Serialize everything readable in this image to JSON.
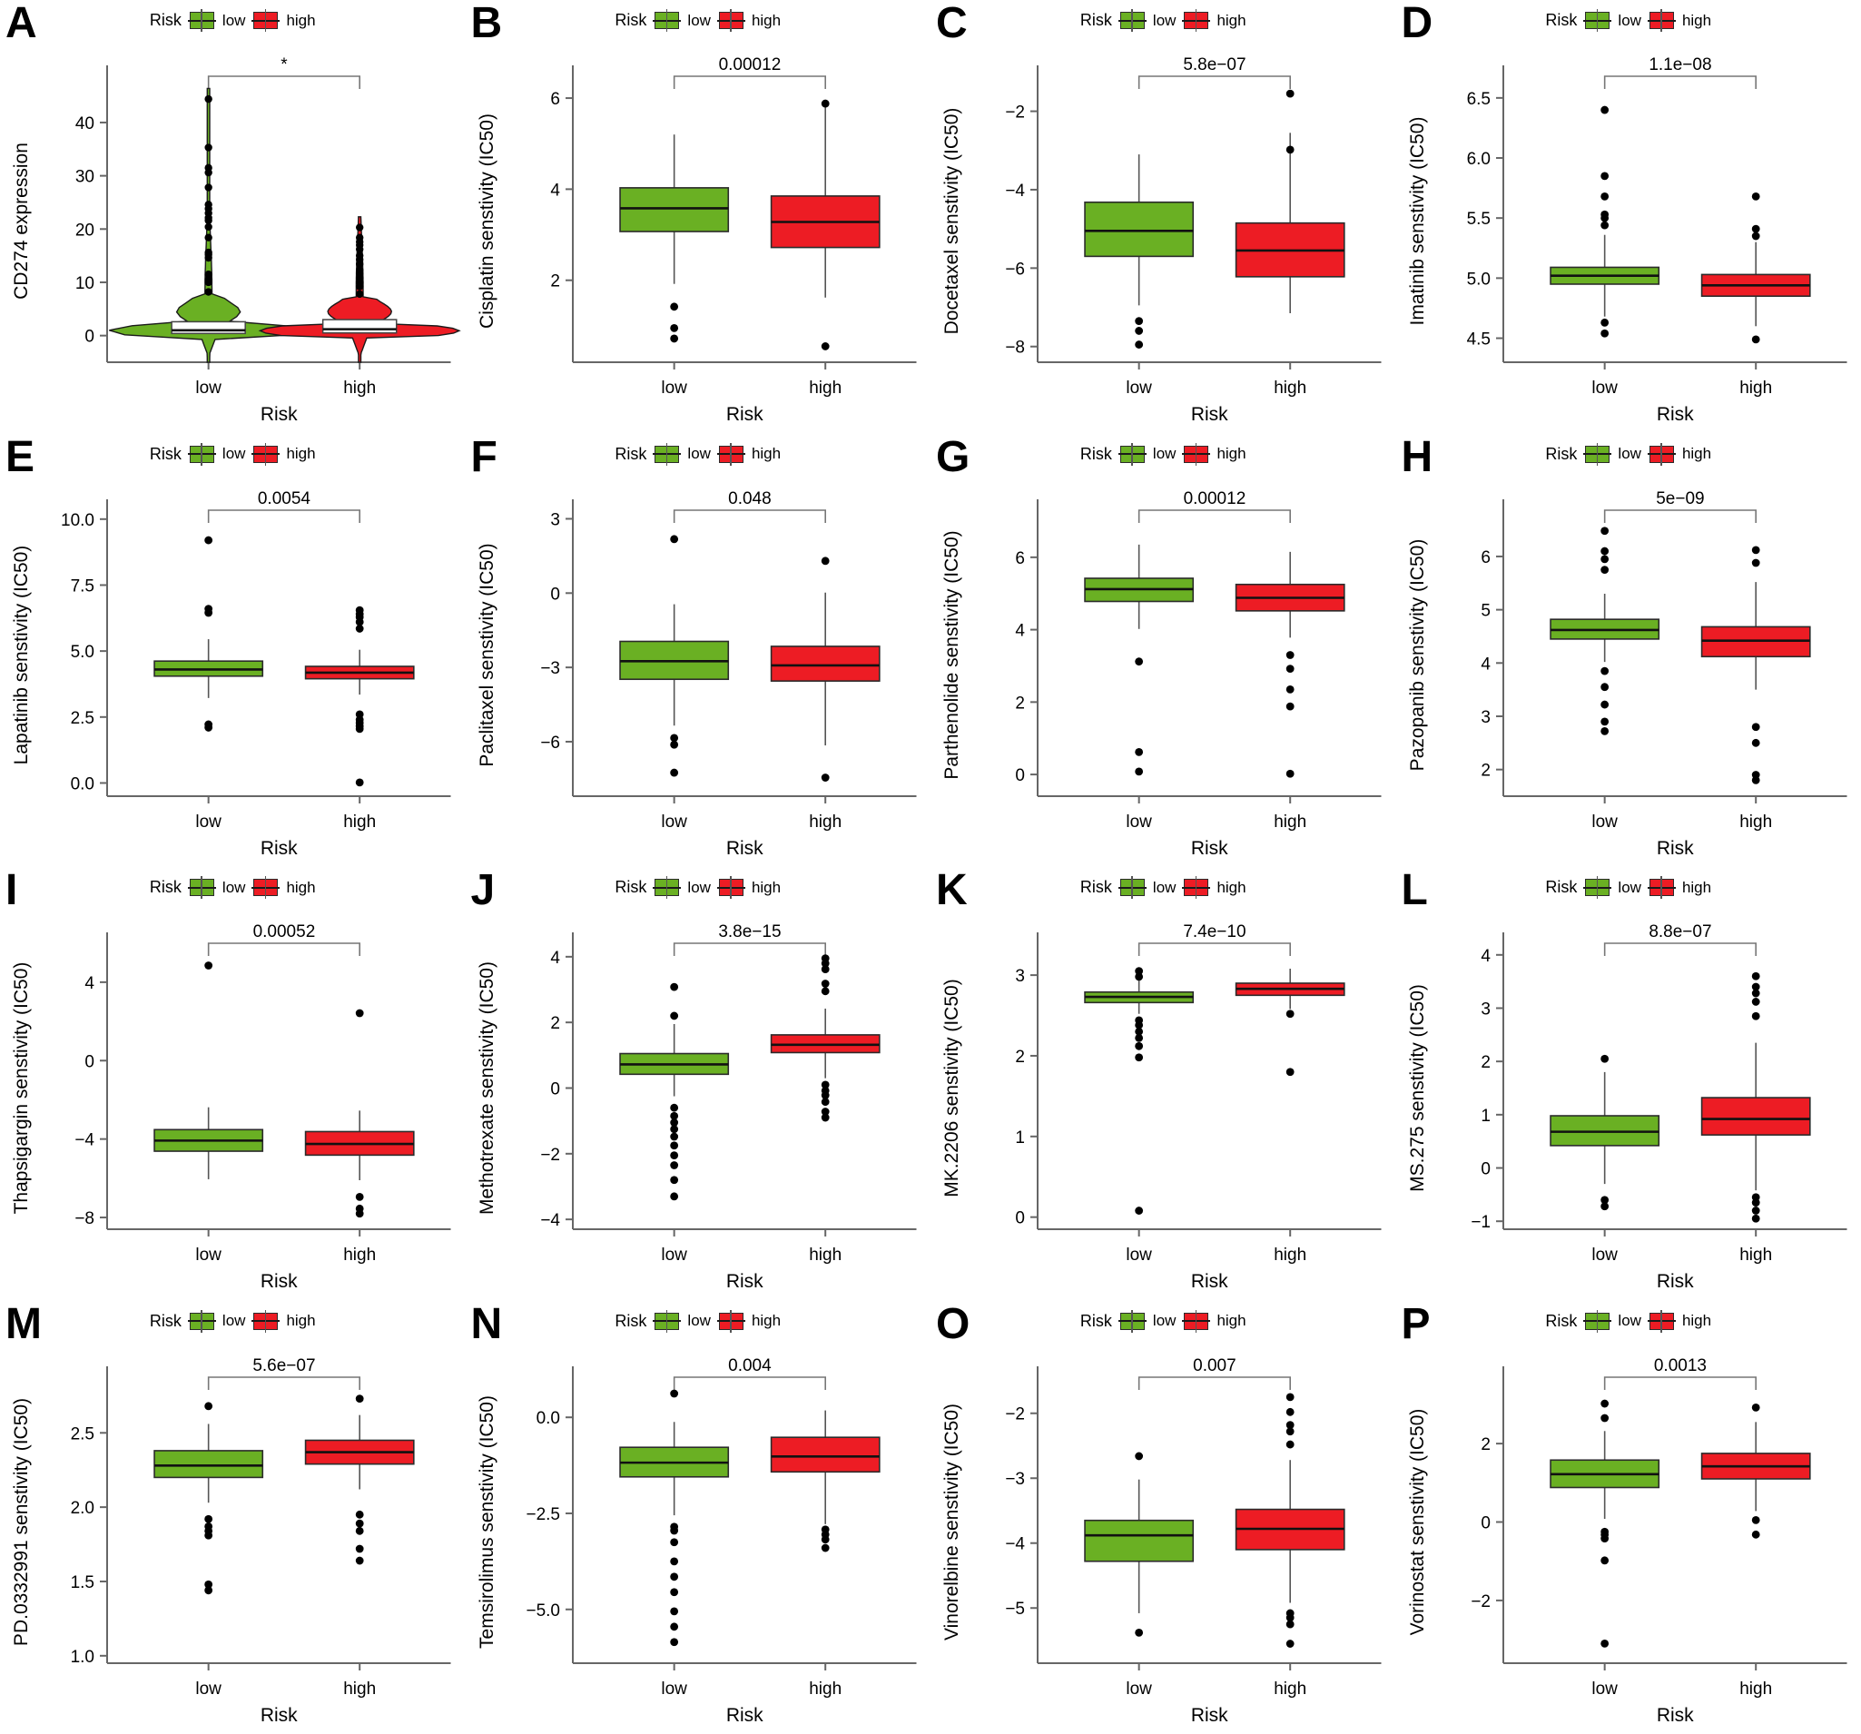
{
  "figure": {
    "legend": {
      "title": "Risk",
      "low_label": "low",
      "high_label": "high"
    },
    "colors": {
      "low": "#6ab023",
      "high": "#ed1c24",
      "axis": "#666666",
      "outlier": "#000000"
    },
    "xlabel": "Risk",
    "xticks": [
      "low",
      "high"
    ]
  },
  "chart_data": [
    {
      "panel": "A",
      "type": "violin",
      "title": "",
      "ylabel": "CD274 expression",
      "xlabel": "Risk",
      "categories": [
        "low",
        "high"
      ],
      "ylim": [
        -5,
        48
      ],
      "yticks": [
        0,
        10,
        20,
        30,
        40
      ],
      "ytick_labels": [
        "0",
        "10",
        "20",
        "30",
        "40"
      ],
      "pvalue": "*",
      "grid": false,
      "legend_position": "top-center",
      "series": [
        {
          "name": "low",
          "color": "#6ab023",
          "median": 1.0,
          "q1": 0.4,
          "q3": 2.6,
          "whisker_low": 0.0,
          "whisker_high": 5.2,
          "outliers": [
            8.2,
            10.0,
            10.5,
            11.5,
            14.6,
            15.2,
            15.6,
            18.4,
            20.4,
            21.6,
            22.1,
            23.0,
            23.8,
            24.6,
            27.8,
            30.6,
            31.5,
            35.3,
            44.4
          ]
        },
        {
          "name": "high",
          "color": "#ed1c24",
          "median": 1.2,
          "q1": 0.5,
          "q3": 3.0,
          "whisker_low": 0.0,
          "whisker_high": 6.0,
          "outliers": [
            7.8,
            9.2,
            10.0,
            10.8,
            11.6,
            12.3,
            13.4,
            14.3,
            15.0,
            16.2,
            17.0,
            17.6,
            18.4,
            20.3
          ]
        }
      ]
    },
    {
      "panel": "B",
      "type": "box",
      "ylabel": "Cisplatin senstivity (IC50)",
      "xlabel": "Risk",
      "categories": [
        "low",
        "high"
      ],
      "ylim": [
        0.2,
        6.4
      ],
      "yticks": [
        2,
        4,
        6
      ],
      "ytick_labels": [
        "2",
        "4",
        "6"
      ],
      "pvalue": "0.00012",
      "grid": false,
      "series": [
        {
          "name": "low",
          "color": "#6ab023",
          "median": 3.58,
          "q1": 3.07,
          "q3": 4.03,
          "whisker_low": 1.92,
          "whisker_high": 5.2,
          "outliers": [
            1.42,
            0.95,
            0.72
          ]
        },
        {
          "name": "high",
          "color": "#ed1c24",
          "median": 3.28,
          "q1": 2.72,
          "q3": 3.85,
          "whisker_low": 1.62,
          "whisker_high": 5.88,
          "outliers": [
            5.88,
            0.55
          ]
        }
      ]
    },
    {
      "panel": "C",
      "type": "box",
      "ylabel": "Docetaxel senstivity (IC50)",
      "xlabel": "Risk",
      "categories": [
        "low",
        "high"
      ],
      "ylim": [
        -8.4,
        -1.2
      ],
      "yticks": [
        -8,
        -6,
        -4,
        -2
      ],
      "ytick_labels": [
        "-8",
        "-6",
        "-4",
        "-2"
      ],
      "pvalue": "5.8e-07",
      "grid": false,
      "series": [
        {
          "name": "low",
          "color": "#6ab023",
          "median": -5.05,
          "q1": -5.7,
          "q3": -4.32,
          "whisker_low": -6.95,
          "whisker_high": -3.1,
          "outliers": [
            -7.35,
            -7.6,
            -7.95
          ]
        },
        {
          "name": "high",
          "color": "#ed1c24",
          "median": -5.55,
          "q1": -6.22,
          "q3": -4.85,
          "whisker_low": -7.15,
          "whisker_high": -2.55,
          "outliers": [
            -1.55,
            -2.98
          ]
        }
      ]
    },
    {
      "panel": "D",
      "type": "box",
      "ylabel": "Imatinib senstivity (IC50)",
      "xlabel": "Risk",
      "categories": [
        "low",
        "high"
      ],
      "ylim": [
        4.3,
        6.65
      ],
      "yticks": [
        4.5,
        5.0,
        5.5,
        6.0,
        6.5
      ],
      "ytick_labels": [
        "4.5",
        "5.0",
        "5.5",
        "6.0",
        "6.5"
      ],
      "pvalue": "1.1e-08",
      "grid": false,
      "series": [
        {
          "name": "low",
          "color": "#6ab023",
          "median": 5.02,
          "q1": 4.95,
          "q3": 5.09,
          "whisker_low": 4.68,
          "whisker_high": 5.36,
          "outliers": [
            6.4,
            5.85,
            5.68,
            5.53,
            5.5,
            5.44,
            4.63,
            4.54
          ]
        },
        {
          "name": "high",
          "color": "#ed1c24",
          "median": 4.94,
          "q1": 4.85,
          "q3": 5.03,
          "whisker_low": 4.6,
          "whisker_high": 5.3,
          "outliers": [
            5.68,
            5.41,
            5.35,
            4.49
          ]
        }
      ]
    },
    {
      "panel": "E",
      "type": "box",
      "ylabel": "Lapatinib senstivity (IC50)",
      "xlabel": "Risk",
      "categories": [
        "low",
        "high"
      ],
      "ylim": [
        -0.5,
        10.2
      ],
      "yticks": [
        0.0,
        2.5,
        5.0,
        7.5,
        10.0
      ],
      "ytick_labels": [
        "0.0",
        "2.5",
        "5.0",
        "7.5",
        "10.0"
      ],
      "pvalue": "0.0054",
      "grid": false,
      "series": [
        {
          "name": "low",
          "color": "#6ab023",
          "median": 4.3,
          "q1": 4.05,
          "q3": 4.62,
          "whisker_low": 3.22,
          "whisker_high": 5.45,
          "outliers": [
            9.2,
            6.6,
            6.45,
            2.22,
            2.1
          ]
        },
        {
          "name": "high",
          "color": "#ed1c24",
          "median": 4.18,
          "q1": 3.95,
          "q3": 4.42,
          "whisker_low": 3.35,
          "whisker_high": 5.05,
          "outliers": [
            6.55,
            6.4,
            6.28,
            6.1,
            5.85,
            2.6,
            2.4,
            2.28,
            2.15,
            2.05,
            0.02
          ]
        }
      ]
    },
    {
      "panel": "F",
      "type": "box",
      "ylabel": "Paclitaxel senstivity (IC50)",
      "xlabel": "Risk",
      "categories": [
        "low",
        "high"
      ],
      "ylim": [
        -8.2,
        3.2
      ],
      "yticks": [
        -6,
        -3,
        0,
        3
      ],
      "ytick_labels": [
        "-6",
        "-3",
        "0",
        "3"
      ],
      "pvalue": "0.048",
      "grid": false,
      "series": [
        {
          "name": "low",
          "color": "#6ab023",
          "median": -2.75,
          "q1": -3.48,
          "q3": -1.95,
          "whisker_low": -5.35,
          "whisker_high": -0.45,
          "outliers": [
            2.18,
            -5.85,
            -6.12,
            -7.25
          ]
        },
        {
          "name": "high",
          "color": "#ed1c24",
          "median": -2.92,
          "q1": -3.55,
          "q3": -2.15,
          "whisker_low": -6.15,
          "whisker_high": 0.02,
          "outliers": [
            1.3,
            -7.45
          ]
        }
      ]
    },
    {
      "panel": "G",
      "type": "box",
      "ylabel": "Parthenolide senstivity (IC50)",
      "xlabel": "Risk",
      "categories": [
        "low",
        "high"
      ],
      "ylim": [
        -0.6,
        7.2
      ],
      "yticks": [
        0,
        2,
        4,
        6
      ],
      "ytick_labels": [
        "0",
        "2",
        "4",
        "6"
      ],
      "pvalue": "0.00012",
      "grid": false,
      "series": [
        {
          "name": "low",
          "color": "#6ab023",
          "median": 5.12,
          "q1": 4.78,
          "q3": 5.42,
          "whisker_low": 4.02,
          "whisker_high": 6.35,
          "outliers": [
            3.12,
            0.62,
            0.08
          ]
        },
        {
          "name": "high",
          "color": "#ed1c24",
          "median": 4.88,
          "q1": 4.52,
          "q3": 5.25,
          "whisker_low": 3.78,
          "whisker_high": 6.15,
          "outliers": [
            3.3,
            2.92,
            2.35,
            1.88,
            0.02
          ]
        }
      ]
    },
    {
      "panel": "H",
      "type": "box",
      "ylabel": "Pazopanib senstivity (IC50)",
      "xlabel": "Risk",
      "categories": [
        "low",
        "high"
      ],
      "ylim": [
        1.5,
        6.8
      ],
      "yticks": [
        2,
        3,
        4,
        5,
        6
      ],
      "ytick_labels": [
        "2",
        "3",
        "4",
        "5",
        "6"
      ],
      "pvalue": "5e-09",
      "grid": false,
      "series": [
        {
          "name": "low",
          "color": "#6ab023",
          "median": 4.62,
          "q1": 4.45,
          "q3": 4.82,
          "whisker_low": 4.02,
          "whisker_high": 5.3,
          "outliers": [
            6.48,
            6.1,
            5.95,
            5.75,
            3.85,
            3.55,
            3.22,
            2.9,
            2.72
          ]
        },
        {
          "name": "high",
          "color": "#ed1c24",
          "median": 4.42,
          "q1": 4.12,
          "q3": 4.68,
          "whisker_low": 3.5,
          "whisker_high": 5.52,
          "outliers": [
            6.12,
            5.88,
            2.8,
            2.5,
            1.9,
            1.8
          ]
        }
      ]
    },
    {
      "panel": "I",
      "type": "box",
      "ylabel": "Thapsigargin senstivity (IC50)",
      "xlabel": "Risk",
      "categories": [
        "low",
        "high"
      ],
      "ylim": [
        -8.6,
        5.8
      ],
      "yticks": [
        -8,
        -4,
        0,
        4
      ],
      "ytick_labels": [
        "-8",
        "-4",
        "0",
        "4"
      ],
      "pvalue": "0.00052",
      "grid": false,
      "series": [
        {
          "name": "low",
          "color": "#6ab023",
          "median": -4.08,
          "q1": -4.62,
          "q3": -3.52,
          "whisker_low": -6.05,
          "whisker_high": -2.38,
          "outliers": [
            4.85
          ]
        },
        {
          "name": "high",
          "color": "#ed1c24",
          "median": -4.25,
          "q1": -4.82,
          "q3": -3.62,
          "whisker_low": -6.1,
          "whisker_high": -2.55,
          "outliers": [
            2.42,
            -6.95,
            -7.55,
            -7.8
          ]
        }
      ]
    },
    {
      "panel": "J",
      "type": "box",
      "ylabel": "Methotrexate senstivity (IC50)",
      "xlabel": "Risk",
      "categories": [
        "low",
        "high"
      ],
      "ylim": [
        -4.3,
        4.3
      ],
      "yticks": [
        -4,
        -2,
        0,
        2,
        4
      ],
      "ytick_labels": [
        "-4",
        "-2",
        "0",
        "2",
        "4"
      ],
      "pvalue": "3.8e-15",
      "grid": false,
      "series": [
        {
          "name": "low",
          "color": "#6ab023",
          "median": 0.72,
          "q1": 0.42,
          "q3": 1.05,
          "whisker_low": -0.25,
          "whisker_high": 1.95,
          "outliers": [
            3.08,
            2.2,
            -0.6,
            -0.85,
            -1.05,
            -1.25,
            -1.48,
            -1.75,
            -2.05,
            -2.35,
            -2.8,
            -3.3
          ]
        },
        {
          "name": "high",
          "color": "#ed1c24",
          "median": 1.32,
          "q1": 1.08,
          "q3": 1.62,
          "whisker_low": 0.3,
          "whisker_high": 2.42,
          "outliers": [
            3.95,
            3.8,
            3.62,
            3.18,
            2.95,
            0.1,
            -0.08,
            -0.22,
            -0.42,
            -0.72,
            -0.9
          ]
        }
      ]
    },
    {
      "panel": "K",
      "type": "box",
      "ylabel": "MK.2206 senstivity (IC50)",
      "xlabel": "Risk",
      "categories": [
        "low",
        "high"
      ],
      "ylim": [
        -0.15,
        3.35
      ],
      "yticks": [
        0,
        1,
        2,
        3
      ],
      "ytick_labels": [
        "0",
        "1",
        "2",
        "3"
      ],
      "pvalue": "7.4e-10",
      "grid": false,
      "series": [
        {
          "name": "low",
          "color": "#6ab023",
          "median": 2.73,
          "q1": 2.66,
          "q3": 2.79,
          "whisker_low": 2.52,
          "whisker_high": 2.96,
          "outliers": [
            3.05,
            2.98,
            2.44,
            2.38,
            2.3,
            2.22,
            2.12,
            1.98,
            0.08
          ]
        },
        {
          "name": "high",
          "color": "#ed1c24",
          "median": 2.83,
          "q1": 2.75,
          "q3": 2.9,
          "whisker_low": 2.58,
          "whisker_high": 3.08,
          "outliers": [
            2.52,
            1.8
          ]
        }
      ]
    },
    {
      "panel": "L",
      "type": "box",
      "ylabel": "MS.275 senstivity (IC50)",
      "xlabel": "Risk",
      "categories": [
        "low",
        "high"
      ],
      "ylim": [
        -1.15,
        4.15
      ],
      "yticks": [
        -1,
        0,
        1,
        2,
        3,
        4
      ],
      "ytick_labels": [
        "-1",
        "0",
        "1",
        "2",
        "3",
        "4"
      ],
      "pvalue": "8.8e-07",
      "grid": false,
      "series": [
        {
          "name": "low",
          "color": "#6ab023",
          "median": 0.68,
          "q1": 0.42,
          "q3": 0.98,
          "whisker_low": -0.3,
          "whisker_high": 1.8,
          "outliers": [
            2.05,
            -0.6,
            -0.72
          ]
        },
        {
          "name": "high",
          "color": "#ed1c24",
          "median": 0.92,
          "q1": 0.62,
          "q3": 1.32,
          "whisker_low": -0.42,
          "whisker_high": 2.35,
          "outliers": [
            3.6,
            3.4,
            3.28,
            3.12,
            2.85,
            -0.55,
            -0.65,
            -0.8,
            -0.95
          ]
        }
      ]
    },
    {
      "panel": "M",
      "type": "box",
      "ylabel": "PD.0332991 senstivity (IC50)",
      "xlabel": "Risk",
      "categories": [
        "low",
        "high"
      ],
      "ylim": [
        0.95,
        2.85
      ],
      "yticks": [
        1.0,
        1.5,
        2.0,
        2.5
      ],
      "ytick_labels": [
        "1.0",
        "1.5",
        "2.0",
        "2.5"
      ],
      "pvalue": "5.6e-07",
      "grid": false,
      "series": [
        {
          "name": "low",
          "color": "#6ab023",
          "median": 2.28,
          "q1": 2.2,
          "q3": 2.38,
          "whisker_low": 2.03,
          "whisker_high": 2.56,
          "outliers": [
            2.68,
            1.92,
            1.87,
            1.84,
            1.81,
            1.48,
            1.44
          ]
        },
        {
          "name": "high",
          "color": "#ed1c24",
          "median": 2.37,
          "q1": 2.29,
          "q3": 2.45,
          "whisker_low": 2.12,
          "whisker_high": 2.62,
          "outliers": [
            2.73,
            1.95,
            1.89,
            1.84,
            1.72,
            1.64
          ]
        }
      ]
    },
    {
      "panel": "N",
      "type": "box",
      "ylabel": "Temsirolimus senstivity (IC50)",
      "xlabel": "Risk",
      "categories": [
        "low",
        "high"
      ],
      "ylim": [
        -6.4,
        0.95
      ],
      "yticks": [
        -5.0,
        -2.5,
        0.0
      ],
      "ytick_labels": [
        "-5.0",
        "-2.5",
        "0.0"
      ],
      "pvalue": "0.004",
      "grid": false,
      "series": [
        {
          "name": "low",
          "color": "#6ab023",
          "median": -1.18,
          "q1": -1.55,
          "q3": -0.78,
          "whisker_low": -2.55,
          "whisker_high": -0.12,
          "outliers": [
            0.62,
            -2.85,
            -2.95,
            -3.25,
            -3.75,
            -4.15,
            -4.55,
            -5.05,
            -5.45,
            -5.85
          ]
        },
        {
          "name": "high",
          "color": "#ed1c24",
          "median": -1.02,
          "q1": -1.42,
          "q3": -0.52,
          "whisker_low": -2.78,
          "whisker_high": 0.18,
          "outliers": [
            -2.92,
            -3.05,
            -3.18,
            -3.4
          ]
        }
      ]
    },
    {
      "panel": "O",
      "type": "box",
      "ylabel": "Vinorelbine senstivity (IC50)",
      "xlabel": "Risk",
      "categories": [
        "low",
        "high"
      ],
      "ylim": [
        -5.85,
        -1.5
      ],
      "yticks": [
        -5,
        -4,
        -3,
        -2
      ],
      "ytick_labels": [
        "-5",
        "-4",
        "-3",
        "-2"
      ],
      "pvalue": "0.007",
      "grid": false,
      "series": [
        {
          "name": "low",
          "color": "#6ab023",
          "median": -3.88,
          "q1": -4.28,
          "q3": -3.65,
          "whisker_low": -5.08,
          "whisker_high": -3.02,
          "outliers": [
            -2.66,
            -5.38
          ]
        },
        {
          "name": "high",
          "color": "#ed1c24",
          "median": -3.78,
          "q1": -4.1,
          "q3": -3.48,
          "whisker_low": -4.92,
          "whisker_high": -2.72,
          "outliers": [
            -1.75,
            -1.98,
            -2.18,
            -2.28,
            -2.48,
            -5.08,
            -5.15,
            -5.25,
            -5.55
          ]
        }
      ]
    },
    {
      "panel": "P",
      "type": "box",
      "ylabel": "Vorinostat senstivity (IC50)",
      "xlabel": "Risk",
      "categories": [
        "low",
        "high"
      ],
      "ylim": [
        -3.6,
        3.6
      ],
      "yticks": [
        -2,
        0,
        2
      ],
      "ytick_labels": [
        "-2",
        "0",
        "2"
      ],
      "pvalue": "0.0013",
      "grid": false,
      "series": [
        {
          "name": "low",
          "color": "#6ab023",
          "median": 1.22,
          "q1": 0.88,
          "q3": 1.58,
          "whisker_low": 0.08,
          "whisker_high": 2.32,
          "outliers": [
            3.02,
            2.65,
            -0.25,
            -0.32,
            -0.42,
            -0.98,
            -3.1
          ]
        },
        {
          "name": "high",
          "color": "#ed1c24",
          "median": 1.42,
          "q1": 1.1,
          "q3": 1.75,
          "whisker_low": 0.28,
          "whisker_high": 2.55,
          "outliers": [
            2.92,
            0.05,
            -0.32
          ]
        }
      ]
    }
  ]
}
